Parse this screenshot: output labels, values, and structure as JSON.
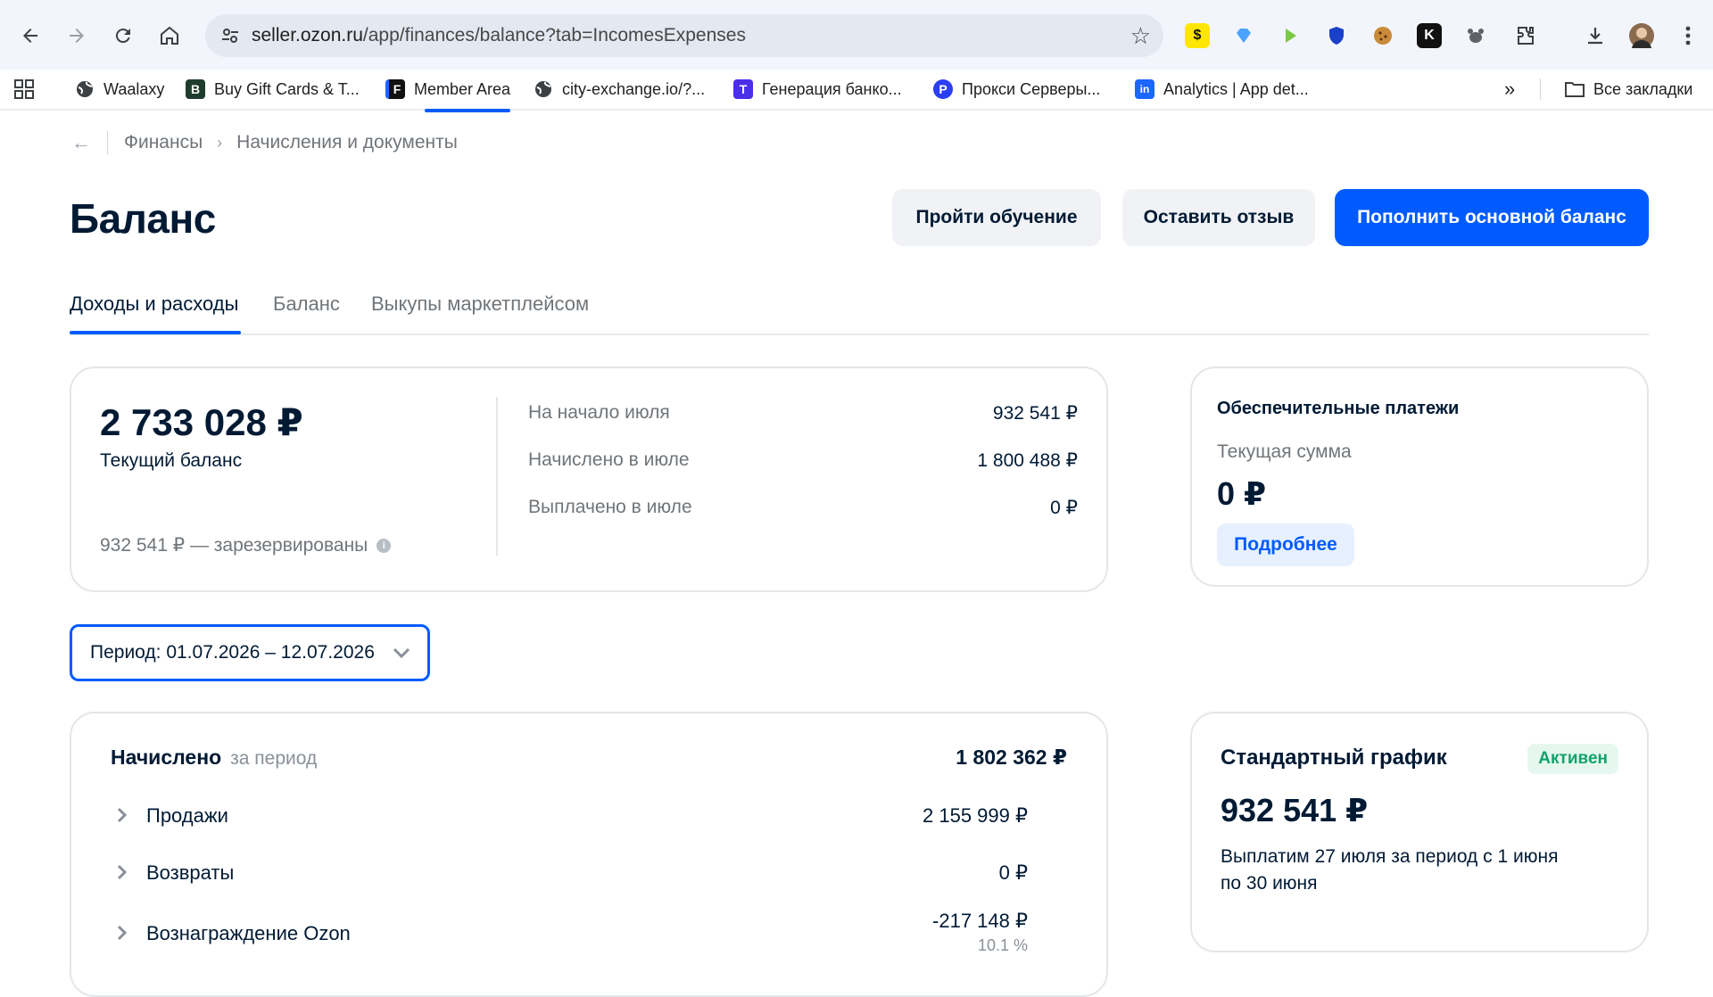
{
  "browser": {
    "url_host": "seller.ozon.ru",
    "url_path": "/app/finances/balance?tab=IncomesExpenses",
    "bookmarks": [
      {
        "label": "Waalaxy",
        "color": "#3c4043"
      },
      {
        "label": "Buy Gift Cards & T...",
        "color": "#1e3d2f",
        "icon_text": "B"
      },
      {
        "label": "Member Area",
        "color": "#111111",
        "icon_text": "F"
      },
      {
        "label": "city-exchange.io/?...",
        "color": "#3c4043"
      },
      {
        "label": "Генерация банко...",
        "color": "#4b2ee8",
        "icon_text": "T"
      },
      {
        "label": "Прокси Серверы...",
        "color": "#2a3ef2",
        "icon_text": "P"
      },
      {
        "label": "Analytics | App det...",
        "color": "#1a66ff",
        "icon_text": "in"
      }
    ],
    "all_bookmarks_label": "Все закладки"
  },
  "breadcrumb": {
    "items": [
      "Финансы",
      "Начисления и документы"
    ]
  },
  "header": {
    "title": "Баланс",
    "btn_training": "Пройти обучение",
    "btn_feedback": "Оставить отзыв",
    "btn_topup": "Пополнить основной баланс"
  },
  "tabs": [
    "Доходы и расходы",
    "Баланс",
    "Выкупы маркетплейсом"
  ],
  "balance_card": {
    "amount": "2 733 028 ₽",
    "label": "Текущий баланс",
    "reserved": "932 541 ₽ — зарезервированы",
    "rows": [
      {
        "label": "На начало июля",
        "value": "932 541 ₽"
      },
      {
        "label": "Начислено в июле",
        "value": "1 800 488 ₽"
      },
      {
        "label": "Выплачено в июле",
        "value": "0 ₽"
      }
    ]
  },
  "security_card": {
    "title": "Обеспечительные платежи",
    "subtitle": "Текущая сумма",
    "amount": "0 ₽",
    "link": "Подробнее"
  },
  "period": {
    "label": "Период: 01.07.2026 – 12.07.2026"
  },
  "accrued_card": {
    "title": "Начислено",
    "title_muted": "за период",
    "total": "1 802 362 ₽",
    "rows": [
      {
        "label": "Продажи",
        "value": "2 155 999 ₽"
      },
      {
        "label": "Возвраты",
        "value": "0 ₽"
      },
      {
        "label": "Вознаграждение Ozon",
        "value": "-217 148 ₽",
        "pct": "10.1 %"
      }
    ]
  },
  "schedule_card": {
    "title": "Стандартный график",
    "badge": "Активен",
    "amount": "932 541 ₽",
    "text": "Выплатим 27 июля за период с 1 июня по 30 июня"
  }
}
